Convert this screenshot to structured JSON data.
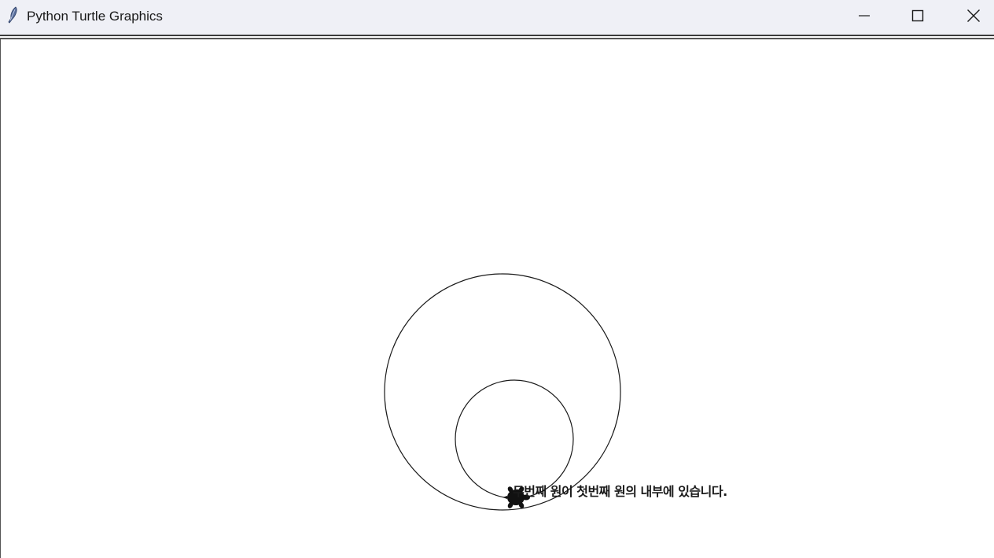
{
  "window": {
    "title": "Python Turtle Graphics",
    "app_icon": "feather-icon",
    "controls": {
      "minimize_icon": "minimize-icon",
      "maximize_icon": "maximize-icon",
      "close_icon": "close-icon"
    }
  },
  "canvas": {
    "message": "두번째 원이 첫번째 원의 내부에 있습니다.",
    "turtle_icon": "turtle-icon",
    "stroke_color": "#1a1a1a",
    "background": "#ffffff"
  }
}
